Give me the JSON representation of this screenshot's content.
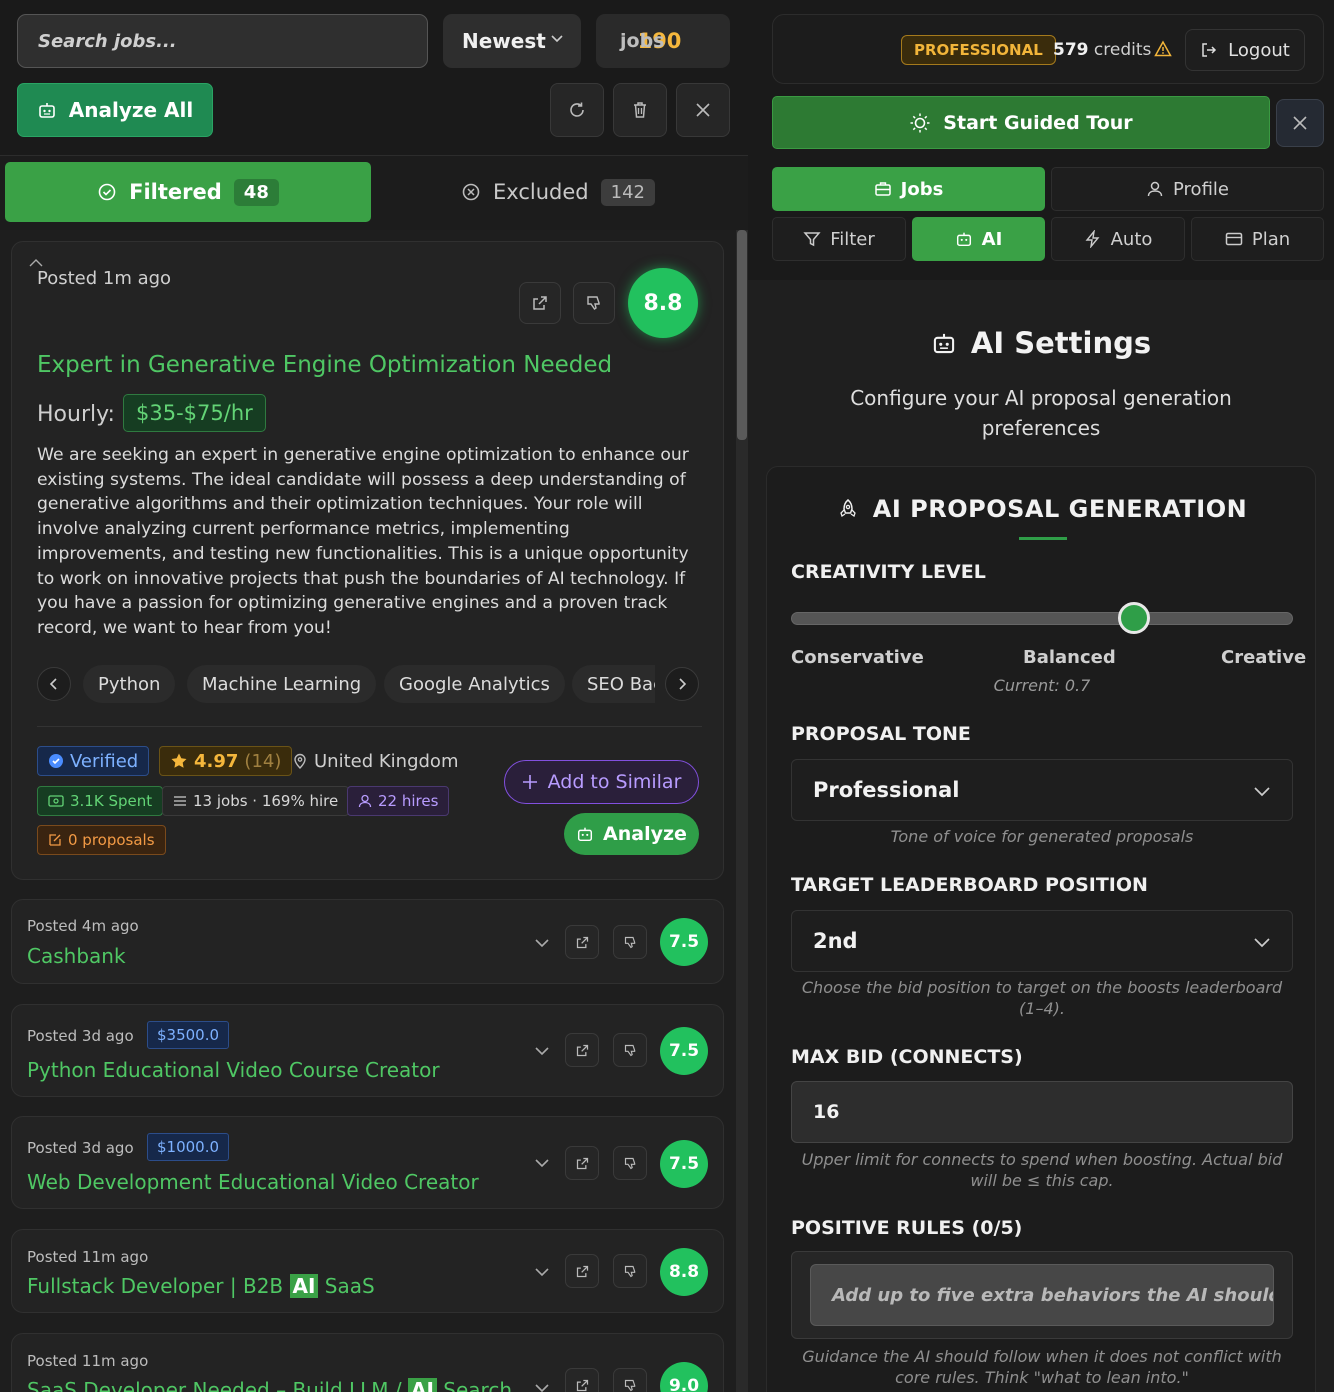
{
  "toolbar": {
    "search_placeholder": "Search jobs...",
    "sort_value": "Newest",
    "job_count": "190",
    "job_count_label": "jobs",
    "analyze_all_label": "Analyze All"
  },
  "tabs": {
    "filtered_label": "Filtered",
    "filtered_count": "48",
    "excluded_label": "Excluded",
    "excluded_count": "142"
  },
  "main_job": {
    "posted": "Posted 1m ago",
    "score": "8.8",
    "title": "Expert in Generative Engine Optimization Needed",
    "rate_label": "Hourly:",
    "rate": "$35-$75/hr",
    "description": "We are seeking an expert in generative engine optimization to enhance our existing systems. The ideal candidate will possess a deep understanding of generative algorithms and their optimization techniques. Your role will involve analyzing current performance metrics, implementing improvements, and testing new functionalities. This is a unique opportunity to work on innovative projects that push the boundaries of AI technology. If you have a passion for optimizing generative engines and a proven track record, we want to hear from you!",
    "skills": [
      "Python",
      "Machine Learning",
      "Google Analytics",
      "SEO Backlinking"
    ],
    "verified_label": "Verified",
    "rating": "4.97",
    "rating_count": "(14)",
    "country": "United Kingdom",
    "spent": "3.1K Spent",
    "jobs_hire": "13 jobs · 169% hire",
    "hires": "22 hires",
    "proposals": "0 proposals",
    "add_similar_label": "Add to Similar",
    "analyze_label": "Analyze"
  },
  "jobs": [
    {
      "posted": "Posted 4m ago",
      "budget": "",
      "title": "Cashbank",
      "title_ai": "",
      "title_after": "",
      "score": "7.5"
    },
    {
      "posted": "Posted 3d ago",
      "budget": "$3500.0",
      "title": "Python Educational Video Course Creator",
      "title_ai": "",
      "title_after": "",
      "score": "7.5"
    },
    {
      "posted": "Posted 3d ago",
      "budget": "$1000.0",
      "title": "Web Development Educational Video Creator",
      "title_ai": "",
      "title_after": "",
      "score": "7.5"
    },
    {
      "posted": "Posted 11m ago",
      "budget": "",
      "title": "Fullstack Developer | B2B ",
      "title_ai": "AI",
      "title_after": " SaaS",
      "score": "8.8"
    },
    {
      "posted": "Posted 11m ago",
      "budget": "",
      "title": "SaaS Developer Needed – Build LLM / ",
      "title_ai": "AI",
      "title_after": " Search",
      "score": "9.0"
    }
  ],
  "header": {
    "plan": "PROFESSIONAL",
    "credits_num": "579",
    "credits_label": "credits",
    "logout_label": "Logout",
    "tour_label": "Start Guided Tour"
  },
  "nav": {
    "jobs": "Jobs",
    "profile": "Profile",
    "filter": "Filter",
    "ai": "AI",
    "auto": "Auto",
    "plan": "Plan"
  },
  "settings": {
    "title": "AI Settings",
    "subtitle": "Configure your AI proposal generation preferences",
    "section_title": "AI PROPOSAL GENERATION",
    "creativity_label": "CREATIVITY LEVEL",
    "creativity_value": 0.7,
    "creativity_min_label": "Conservative",
    "creativity_mid_label": "Balanced",
    "creativity_max_label": "Creative",
    "creativity_current": "Current: 0.7",
    "tone_label": "PROPOSAL TONE",
    "tone_value": "Professional",
    "tone_hint": "Tone of voice for generated proposals",
    "leaderboard_label": "TARGET LEADERBOARD POSITION",
    "leaderboard_value": "2nd",
    "leaderboard_hint": "Choose the bid position to target on the boosts leaderboard (1–4).",
    "maxbid_label": "MAX BID (CONNECTS)",
    "maxbid_value": "16",
    "maxbid_hint": "Upper limit for connects to spend when boosting. Actual bid will be ≤ this cap.",
    "rules_label": "POSITIVE RULES (0/5)",
    "rules_placeholder": "Add up to five extra behaviors the AI should prioritize",
    "rules_hint": "Guidance the AI should follow when it does not conflict with core rules. Think \"what to lean into.\""
  }
}
